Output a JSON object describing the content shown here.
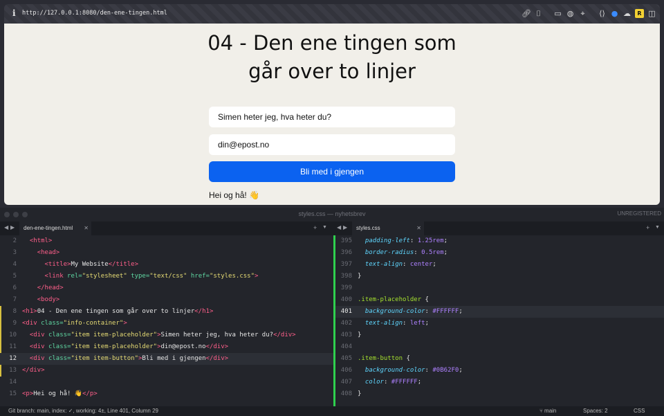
{
  "browser": {
    "url": "http://127.0.0.1:8080/den-ene-tingen.html",
    "info_icon": "i"
  },
  "page": {
    "heading_line1": "04 - Den ene tingen som",
    "heading_line2": "går over to linjer",
    "item1": "Simen heter jeg, hva heter du?",
    "item2": "din@epost.no",
    "button": "Bli med i gjengen",
    "paragraph": "Hei og hå! 👋",
    "button_color": "#0B62F0"
  },
  "editor": {
    "window_title": "styles.css — nyhetsbrev",
    "unregistered": "UNREGISTERED",
    "left_tab": "den-ene-tingen.html",
    "right_tab": "styles.css",
    "left_lines": [
      {
        "n": "2",
        "tokens": [
          [
            "p",
            "  "
          ],
          [
            "tag",
            "<html>"
          ]
        ]
      },
      {
        "n": "3",
        "tokens": [
          [
            "p",
            "    "
          ],
          [
            "tag",
            "<head>"
          ]
        ]
      },
      {
        "n": "4",
        "tokens": [
          [
            "p",
            "      "
          ],
          [
            "tag",
            "<title>"
          ],
          [
            "p",
            "My Website"
          ],
          [
            "tag",
            "</title>"
          ]
        ]
      },
      {
        "n": "5",
        "tokens": [
          [
            "p",
            "      "
          ],
          [
            "tag",
            "<link "
          ],
          [
            "attr",
            "rel="
          ],
          [
            "str",
            "\"stylesheet\""
          ],
          [
            "p",
            " "
          ],
          [
            "attr",
            "type="
          ],
          [
            "str",
            "\"text/css\""
          ],
          [
            "p",
            " "
          ],
          [
            "attr",
            "href="
          ],
          [
            "str",
            "\"styles.css\""
          ],
          [
            "tag",
            ">"
          ]
        ]
      },
      {
        "n": "6",
        "tokens": [
          [
            "p",
            "    "
          ],
          [
            "tag",
            "</head>"
          ]
        ]
      },
      {
        "n": "7",
        "tokens": [
          [
            "p",
            "    "
          ],
          [
            "tag",
            "<body>"
          ]
        ]
      },
      {
        "n": "8",
        "tokens": [
          [
            "tag",
            "<h1>"
          ],
          [
            "p",
            "04 - Den ene tingen som går over to linjer"
          ],
          [
            "tag",
            "</h1>"
          ]
        ]
      },
      {
        "n": "9",
        "tokens": [
          [
            "tag",
            "<div "
          ],
          [
            "attr",
            "class="
          ],
          [
            "str",
            "\"info-container\""
          ],
          [
            "tag",
            ">"
          ]
        ]
      },
      {
        "n": "10",
        "tokens": [
          [
            "p",
            "  "
          ],
          [
            "tag",
            "<div "
          ],
          [
            "attr",
            "class="
          ],
          [
            "str",
            "\"item item-placeholder\""
          ],
          [
            "tag",
            ">"
          ],
          [
            "p",
            "Simen heter jeg, hva heter du?"
          ],
          [
            "tag",
            "</div>"
          ]
        ]
      },
      {
        "n": "11",
        "tokens": [
          [
            "p",
            "  "
          ],
          [
            "tag",
            "<div "
          ],
          [
            "attr",
            "class="
          ],
          [
            "str",
            "\"item item-placeholder\""
          ],
          [
            "tag",
            ">"
          ],
          [
            "p",
            "din@epost.no"
          ],
          [
            "tag",
            "</div>"
          ]
        ]
      },
      {
        "n": "12",
        "tokens": [
          [
            "p",
            "  "
          ],
          [
            "tag",
            "<div "
          ],
          [
            "attr",
            "class="
          ],
          [
            "str",
            "\"item item-button\""
          ],
          [
            "tag",
            ">"
          ],
          [
            "p",
            "Bli med i gjengen"
          ],
          [
            "tag",
            "</div>"
          ]
        ]
      },
      {
        "n": "13",
        "tokens": [
          [
            "tag",
            "</div>"
          ]
        ]
      },
      {
        "n": "14",
        "tokens": []
      },
      {
        "n": "15",
        "tokens": [
          [
            "tag",
            "<p>"
          ],
          [
            "p",
            "Hei og hå! 👋"
          ],
          [
            "tag",
            "</p>"
          ]
        ]
      }
    ],
    "right_lines": [
      {
        "n": "395",
        "tokens": [
          [
            "p",
            "  "
          ],
          [
            "prop",
            "padding-left"
          ],
          [
            "p",
            ": "
          ],
          [
            "num",
            "1.25rem"
          ],
          [
            "p",
            ";"
          ]
        ]
      },
      {
        "n": "396",
        "tokens": [
          [
            "p",
            "  "
          ],
          [
            "prop",
            "border-radius"
          ],
          [
            "p",
            ": "
          ],
          [
            "num",
            "0.5rem"
          ],
          [
            "p",
            ";"
          ]
        ]
      },
      {
        "n": "397",
        "tokens": [
          [
            "p",
            "  "
          ],
          [
            "prop",
            "text-align"
          ],
          [
            "p",
            ": "
          ],
          [
            "num",
            "center"
          ],
          [
            "p",
            ";"
          ]
        ]
      },
      {
        "n": "398",
        "tokens": [
          [
            "p",
            "}"
          ]
        ]
      },
      {
        "n": "399",
        "tokens": []
      },
      {
        "n": "400",
        "tokens": [
          [
            "sel",
            ".item-placeholder"
          ],
          [
            "p",
            " {"
          ]
        ]
      },
      {
        "n": "401",
        "tokens": [
          [
            "p",
            "  "
          ],
          [
            "prop",
            "background-color"
          ],
          [
            "p",
            ": "
          ],
          [
            "num",
            "#FFFFFF"
          ],
          [
            "p",
            ";"
          ]
        ]
      },
      {
        "n": "402",
        "tokens": [
          [
            "p",
            "  "
          ],
          [
            "prop",
            "text-align"
          ],
          [
            "p",
            ": "
          ],
          [
            "num",
            "left"
          ],
          [
            "p",
            ";"
          ]
        ]
      },
      {
        "n": "403",
        "tokens": [
          [
            "p",
            "}"
          ]
        ]
      },
      {
        "n": "404",
        "tokens": []
      },
      {
        "n": "405",
        "tokens": [
          [
            "sel",
            ".item-button"
          ],
          [
            "p",
            " {"
          ]
        ]
      },
      {
        "n": "406",
        "tokens": [
          [
            "p",
            "  "
          ],
          [
            "prop",
            "background-color"
          ],
          [
            "p",
            ": "
          ],
          [
            "num",
            "#0B62F0"
          ],
          [
            "p",
            ";"
          ]
        ]
      },
      {
        "n": "407",
        "tokens": [
          [
            "p",
            "  "
          ],
          [
            "prop",
            "color"
          ],
          [
            "p",
            ": "
          ],
          [
            "num",
            "#FFFFFF"
          ],
          [
            "p",
            ";"
          ]
        ]
      },
      {
        "n": "408",
        "tokens": [
          [
            "p",
            "}"
          ]
        ]
      }
    ],
    "current_left": "12",
    "current_right": "401",
    "status_left": "Git branch: main, index: ✓, working: 4±, Line 401, Column 29",
    "status_branch": "main",
    "status_spaces": "Spaces: 2",
    "status_lang": "CSS"
  }
}
